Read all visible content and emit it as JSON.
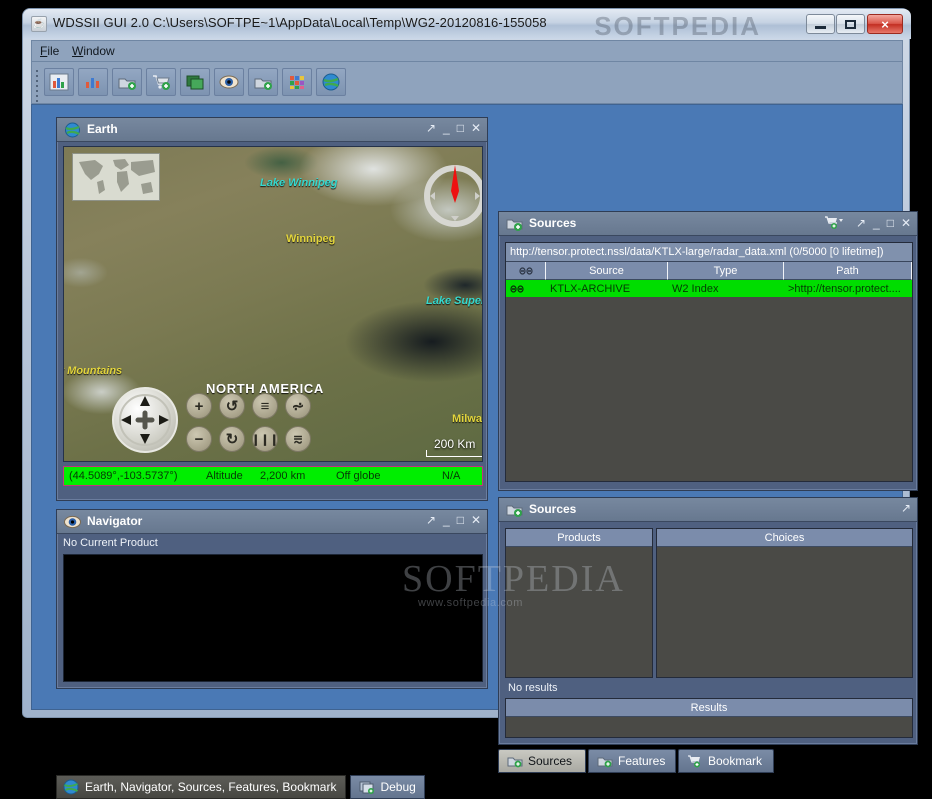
{
  "window": {
    "title": "WDSSII GUI 2.0 C:\\Users\\SOFTPE~1\\AppData\\Local\\Temp\\WG2-20120816-155058",
    "app_icon": "java-cup-icon",
    "watermark": "SOFTPEDIA",
    "controls": {
      "minimize": "minimize-button",
      "maximize": "maximize-button",
      "close": "×"
    }
  },
  "menu": {
    "items": [
      {
        "label": "File"
      },
      {
        "label": "Window"
      }
    ]
  },
  "toolbar": {
    "buttons": [
      {
        "name": "chart-add-icon"
      },
      {
        "name": "chart-icon"
      },
      {
        "name": "source-add-icon"
      },
      {
        "name": "cart-add-icon"
      },
      {
        "name": "layers-icon"
      },
      {
        "name": "eye-icon"
      },
      {
        "name": "source-add-2-icon"
      },
      {
        "name": "grid-color-icon"
      },
      {
        "name": "globe-icon"
      }
    ]
  },
  "earth": {
    "title": "Earth",
    "icon": "globe-icon",
    "controls": [
      "float",
      "minimize",
      "maximize",
      "close"
    ],
    "map_labels": [
      {
        "key": "lake_winnipeg",
        "text": "Lake Winnipeg"
      },
      {
        "key": "winnipeg",
        "text": "Winnipeg"
      },
      {
        "key": "lake_superior",
        "text": "Lake Superior"
      },
      {
        "key": "rocky_mountains",
        "text": "y Mountains"
      },
      {
        "key": "north_america",
        "text": "NORTH AMERICA"
      },
      {
        "key": "milwaukee",
        "text": "Milwa"
      }
    ],
    "scale_bar": "200 Km",
    "nav_controls": [
      {
        "name": "zoom-in-button",
        "glyph": "+"
      },
      {
        "name": "rotate-ccw-button",
        "glyph": "↺"
      },
      {
        "name": "tilt-up-button",
        "glyph": "≡"
      },
      {
        "name": "terrain-up-button",
        "glyph": "⩫"
      },
      {
        "name": "zoom-out-button",
        "glyph": "−"
      },
      {
        "name": "rotate-cw-button",
        "glyph": "↻"
      },
      {
        "name": "bars-button",
        "glyph": "❙❙❙"
      },
      {
        "name": "terrain-down-button",
        "glyph": "⩳"
      }
    ],
    "status": {
      "coordinates": "(44.5089°,-103.5737°)",
      "altitude_label": "Altitude",
      "altitude_value": "2,200 km",
      "globe_state": "Off globe",
      "elevation": "N/A"
    }
  },
  "navigator": {
    "title": "Navigator",
    "icon": "eye-icon",
    "status": "No Current Product"
  },
  "sources_top": {
    "title": "Sources",
    "icon": "source-add-icon",
    "cart_icon": "cart-add-dropdown-icon",
    "url": "http://tensor.protect.nssl/data/KTLX-large/radar_data.xml (0/5000 [0 lifetime])",
    "columns": [
      "link-icon",
      "Source",
      "Type",
      "Path"
    ],
    "rows": [
      {
        "link": "link-icon",
        "source": "KTLX-ARCHIVE",
        "type": "W2 Index",
        "path": ">http://tensor.protect...."
      }
    ]
  },
  "sources_bottom": {
    "title": "Sources",
    "icon": "source-add-icon",
    "products_header": "Products",
    "choices_header": "Choices",
    "no_results": "No results",
    "results_header": "Results"
  },
  "tabs": [
    {
      "label": "Sources",
      "icon": "source-add-icon",
      "active": true
    },
    {
      "label": "Features",
      "icon": "source-add-icon",
      "active": false
    },
    {
      "label": "Bookmark",
      "icon": "cart-add-icon",
      "active": false
    }
  ],
  "statusbar": {
    "panels": "Earth, Navigator, Sources, Features, Bookmark",
    "debug": "Debug"
  },
  "watermark": {
    "big": "SOFTPEDIA",
    "small": "www.softpedia.com"
  },
  "colors": {
    "accent_green": "#00ee00",
    "frame_bg": "#4f6080",
    "desktop_bg": "#4a79b5",
    "header_bg": "#77889f"
  }
}
